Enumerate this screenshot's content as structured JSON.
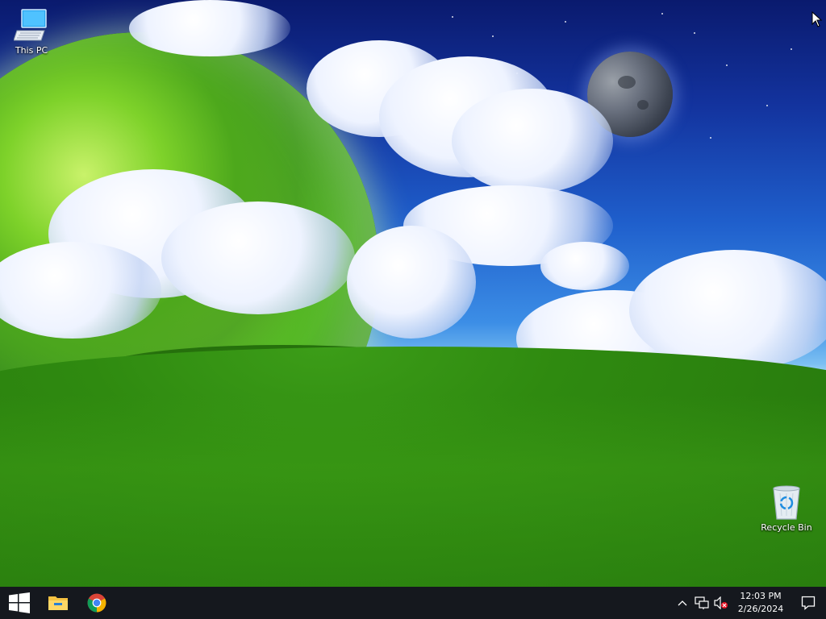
{
  "desktop": {
    "icons": [
      {
        "label": "This PC",
        "icon": "computer-icon"
      },
      {
        "label": "Recycle Bin",
        "icon": "recycle-bin-icon"
      }
    ]
  },
  "taskbar": {
    "start": {
      "icon": "windows-logo-icon"
    },
    "pinned": [
      {
        "icon": "file-explorer-icon"
      },
      {
        "icon": "chrome-icon"
      }
    ],
    "tray": {
      "icons": [
        "chevron-up-icon",
        "network-icon",
        "volume-muted-icon"
      ],
      "time": "12:03 PM",
      "date": "2/26/2024",
      "notification_icon": "action-center-icon"
    }
  },
  "colors": {
    "taskbar": "#15181e",
    "text": "#ffffff"
  }
}
